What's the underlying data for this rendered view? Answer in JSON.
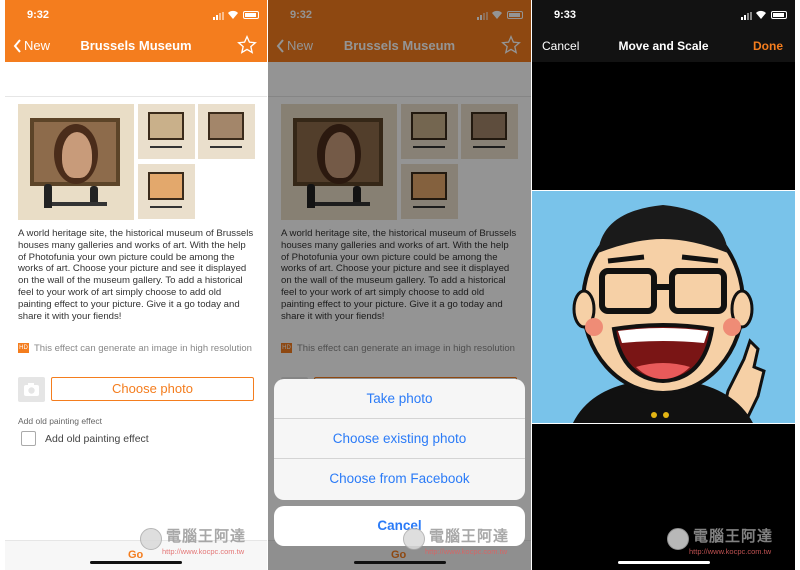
{
  "panel1": {
    "status_time": "9:32",
    "back_label": "New",
    "title": "Brussels Museum",
    "description": "A world heritage site, the historical museum of Brussels houses many galleries and works of art. With the help of Photofunia your own picture could be among the works of art. Choose your picture and see it displayed on the wall of the museum gallery. To add a historical feel to your work of art simply choose to add old painting effect to your picture.  Give it a go today and share it with your fiends!",
    "hd_badge": "HD",
    "hd_note": "This effect can generate an image in high resolution",
    "choose_photo": "Choose photo",
    "option_title": "Add old painting effect",
    "option_checkbox_label": "Add old painting effect",
    "bottom_partial": "Go"
  },
  "panel2": {
    "status_time": "9:32",
    "back_label": "New",
    "title": "Brussels Museum",
    "description": "A world heritage site, the historical museum of Brussels houses many galleries and works of art. With the help of Photofunia your own picture could be among the works of art. Choose your picture and see it displayed on the wall of the museum gallery. To add a historical feel to your work of art simply choose to add old painting effect to your picture.  Give it a go today and share it with your fiends!",
    "hd_badge": "HD",
    "hd_note": "This effect can generate an image in high resolution",
    "action_sheet": [
      "Take photo",
      "Choose existing photo",
      "Choose from Facebook"
    ],
    "cancel": "Cancel",
    "bottom_partial": "Go"
  },
  "panel3": {
    "status_time": "9:33",
    "cancel": "Cancel",
    "title": "Move and Scale",
    "done": "Done"
  },
  "watermark": {
    "title": "電腦王阿達",
    "url": "http://www.kocpc.com.tw"
  },
  "colors": {
    "accent": "#f47d1e",
    "ios_blue": "#2b7bf7",
    "crop_bg": "#79c3ea"
  }
}
